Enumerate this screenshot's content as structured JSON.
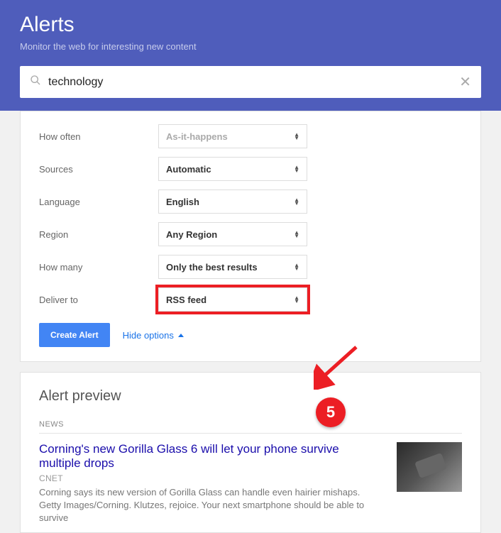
{
  "header": {
    "title": "Alerts",
    "subtitle": "Monitor the web for interesting new content"
  },
  "search": {
    "value": "technology"
  },
  "options": {
    "how_often": {
      "label": "How often",
      "value": "As-it-happens"
    },
    "sources": {
      "label": "Sources",
      "value": "Automatic"
    },
    "language": {
      "label": "Language",
      "value": "English"
    },
    "region": {
      "label": "Region",
      "value": "Any Region"
    },
    "how_many": {
      "label": "How many",
      "value": "Only the best results"
    },
    "deliver_to": {
      "label": "Deliver to",
      "value": "RSS feed"
    }
  },
  "buttons": {
    "create": "Create Alert",
    "hide_options": "Hide options"
  },
  "annotation": {
    "badge": "5"
  },
  "preview": {
    "heading": "Alert preview",
    "section": "NEWS",
    "article": {
      "title": "Corning's new Gorilla Glass 6 will let your phone survive multiple drops",
      "source": "CNET",
      "snippet": "Corning says its new version of Gorilla Glass can handle even hairier mishaps. Getty Images/Corning. Klutzes, rejoice. Your next smartphone should be able to survive"
    }
  }
}
